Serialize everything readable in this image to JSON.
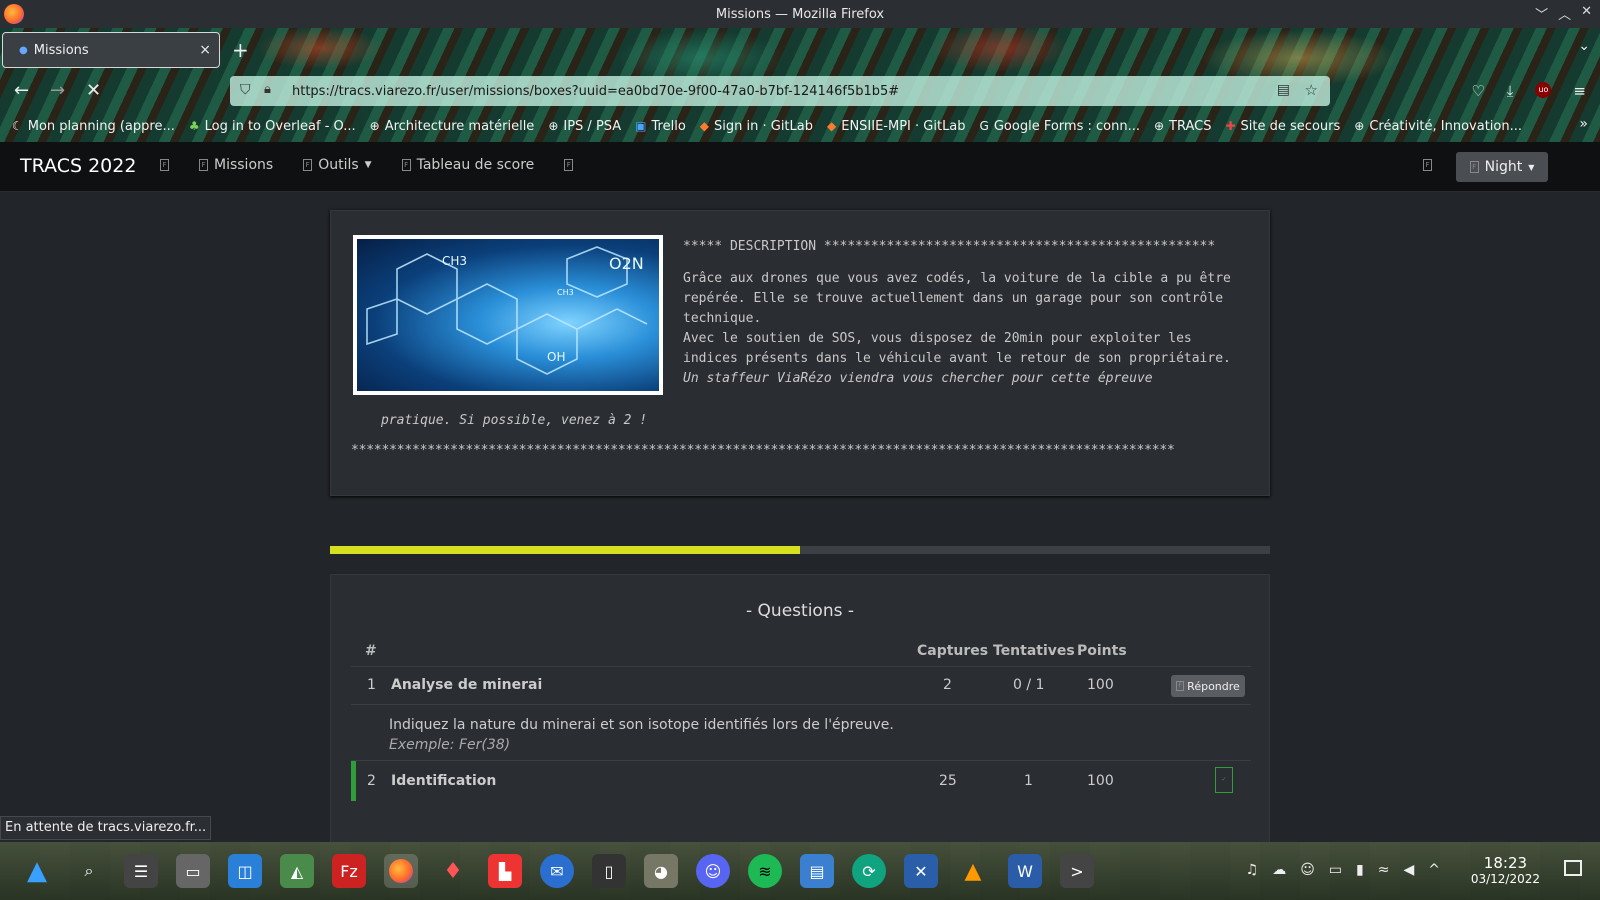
{
  "window": {
    "title": "Missions — Mozilla Firefox"
  },
  "tab": {
    "label": "Missions",
    "close": "×"
  },
  "toolbar": {
    "url": "https://tracs.viarezo.fr/user/missions/boxes?uuid=ea0bd70e-9f00-47a0-b7bf-124146f5b1b5#"
  },
  "bookmarks": [
    {
      "label": "Mon planning (appre...",
      "icon": "moon-icon"
    },
    {
      "label": "Log in to Overleaf - O...",
      "icon": "leaf-icon"
    },
    {
      "label": "Architecture matérielle",
      "icon": "globe-icon"
    },
    {
      "label": "IPS / PSA",
      "icon": "globe-icon"
    },
    {
      "label": "Trello",
      "icon": "trello-icon"
    },
    {
      "label": "Sign in · GitLab",
      "icon": "gitlab-icon"
    },
    {
      "label": "ENSIIE-MPI · GitLab",
      "icon": "gitlab-icon"
    },
    {
      "label": "Google Forms : conn...",
      "icon": "google-icon"
    },
    {
      "label": "TRACS",
      "icon": "globe-icon"
    },
    {
      "label": "Site de secours",
      "icon": "site-icon"
    },
    {
      "label": "Créativité, Innovation...",
      "icon": "globe-icon"
    }
  ],
  "site": {
    "brand": "TRACS 2022",
    "nav": {
      "missions": "Missions",
      "outils": "Outils",
      "scoreboard": "Tableau de score"
    },
    "night_label": "Night"
  },
  "mission": {
    "description_header": "***** DESCRIPTION **************************************************",
    "description_p1": "Grâce aux drones que vous avez codés, la voiture de la cible a pu être repérée. Elle se trouve actuellement dans un garage pour son contrôle technique.",
    "description_p2": "Avec le soutien de SOS, vous disposez de 20min pour exploiter les indices présents dans le véhicule avant le retour de son propriétaire.",
    "description_p3a": "Un staffeur ViaRézo viendra vous chercher pour cette épreuve",
    "description_p3b": "pratique. Si possible, venez à 2 !",
    "description_footer": "************************************************************************************************************",
    "progress": 0.5
  },
  "questions": {
    "title": "- Questions -",
    "headers": {
      "num": "#",
      "captures": "Captures",
      "attempts": "Tentatives",
      "points": "Points"
    },
    "rows": [
      {
        "num": "1",
        "name": "Analyse de minerai",
        "captures": "2",
        "attempts": "0 / 1",
        "points": "100",
        "action": "Répondre",
        "statement": "Indiquez la nature du minerai et son isotope identifiés lors de l'épreuve.",
        "example": "Exemple: Fer(38)"
      },
      {
        "num": "2",
        "name": "Identification",
        "captures": "25",
        "attempts": "1",
        "points": "100"
      }
    ]
  },
  "statusbar": {
    "text": "En attente de tracs.viarezo.fr..."
  },
  "taskbar": {
    "time": "18:23",
    "date": "03/12/2022"
  },
  "colors": {
    "progress_fill": "#d6e01e",
    "solved_border": "#2f9e3a"
  }
}
